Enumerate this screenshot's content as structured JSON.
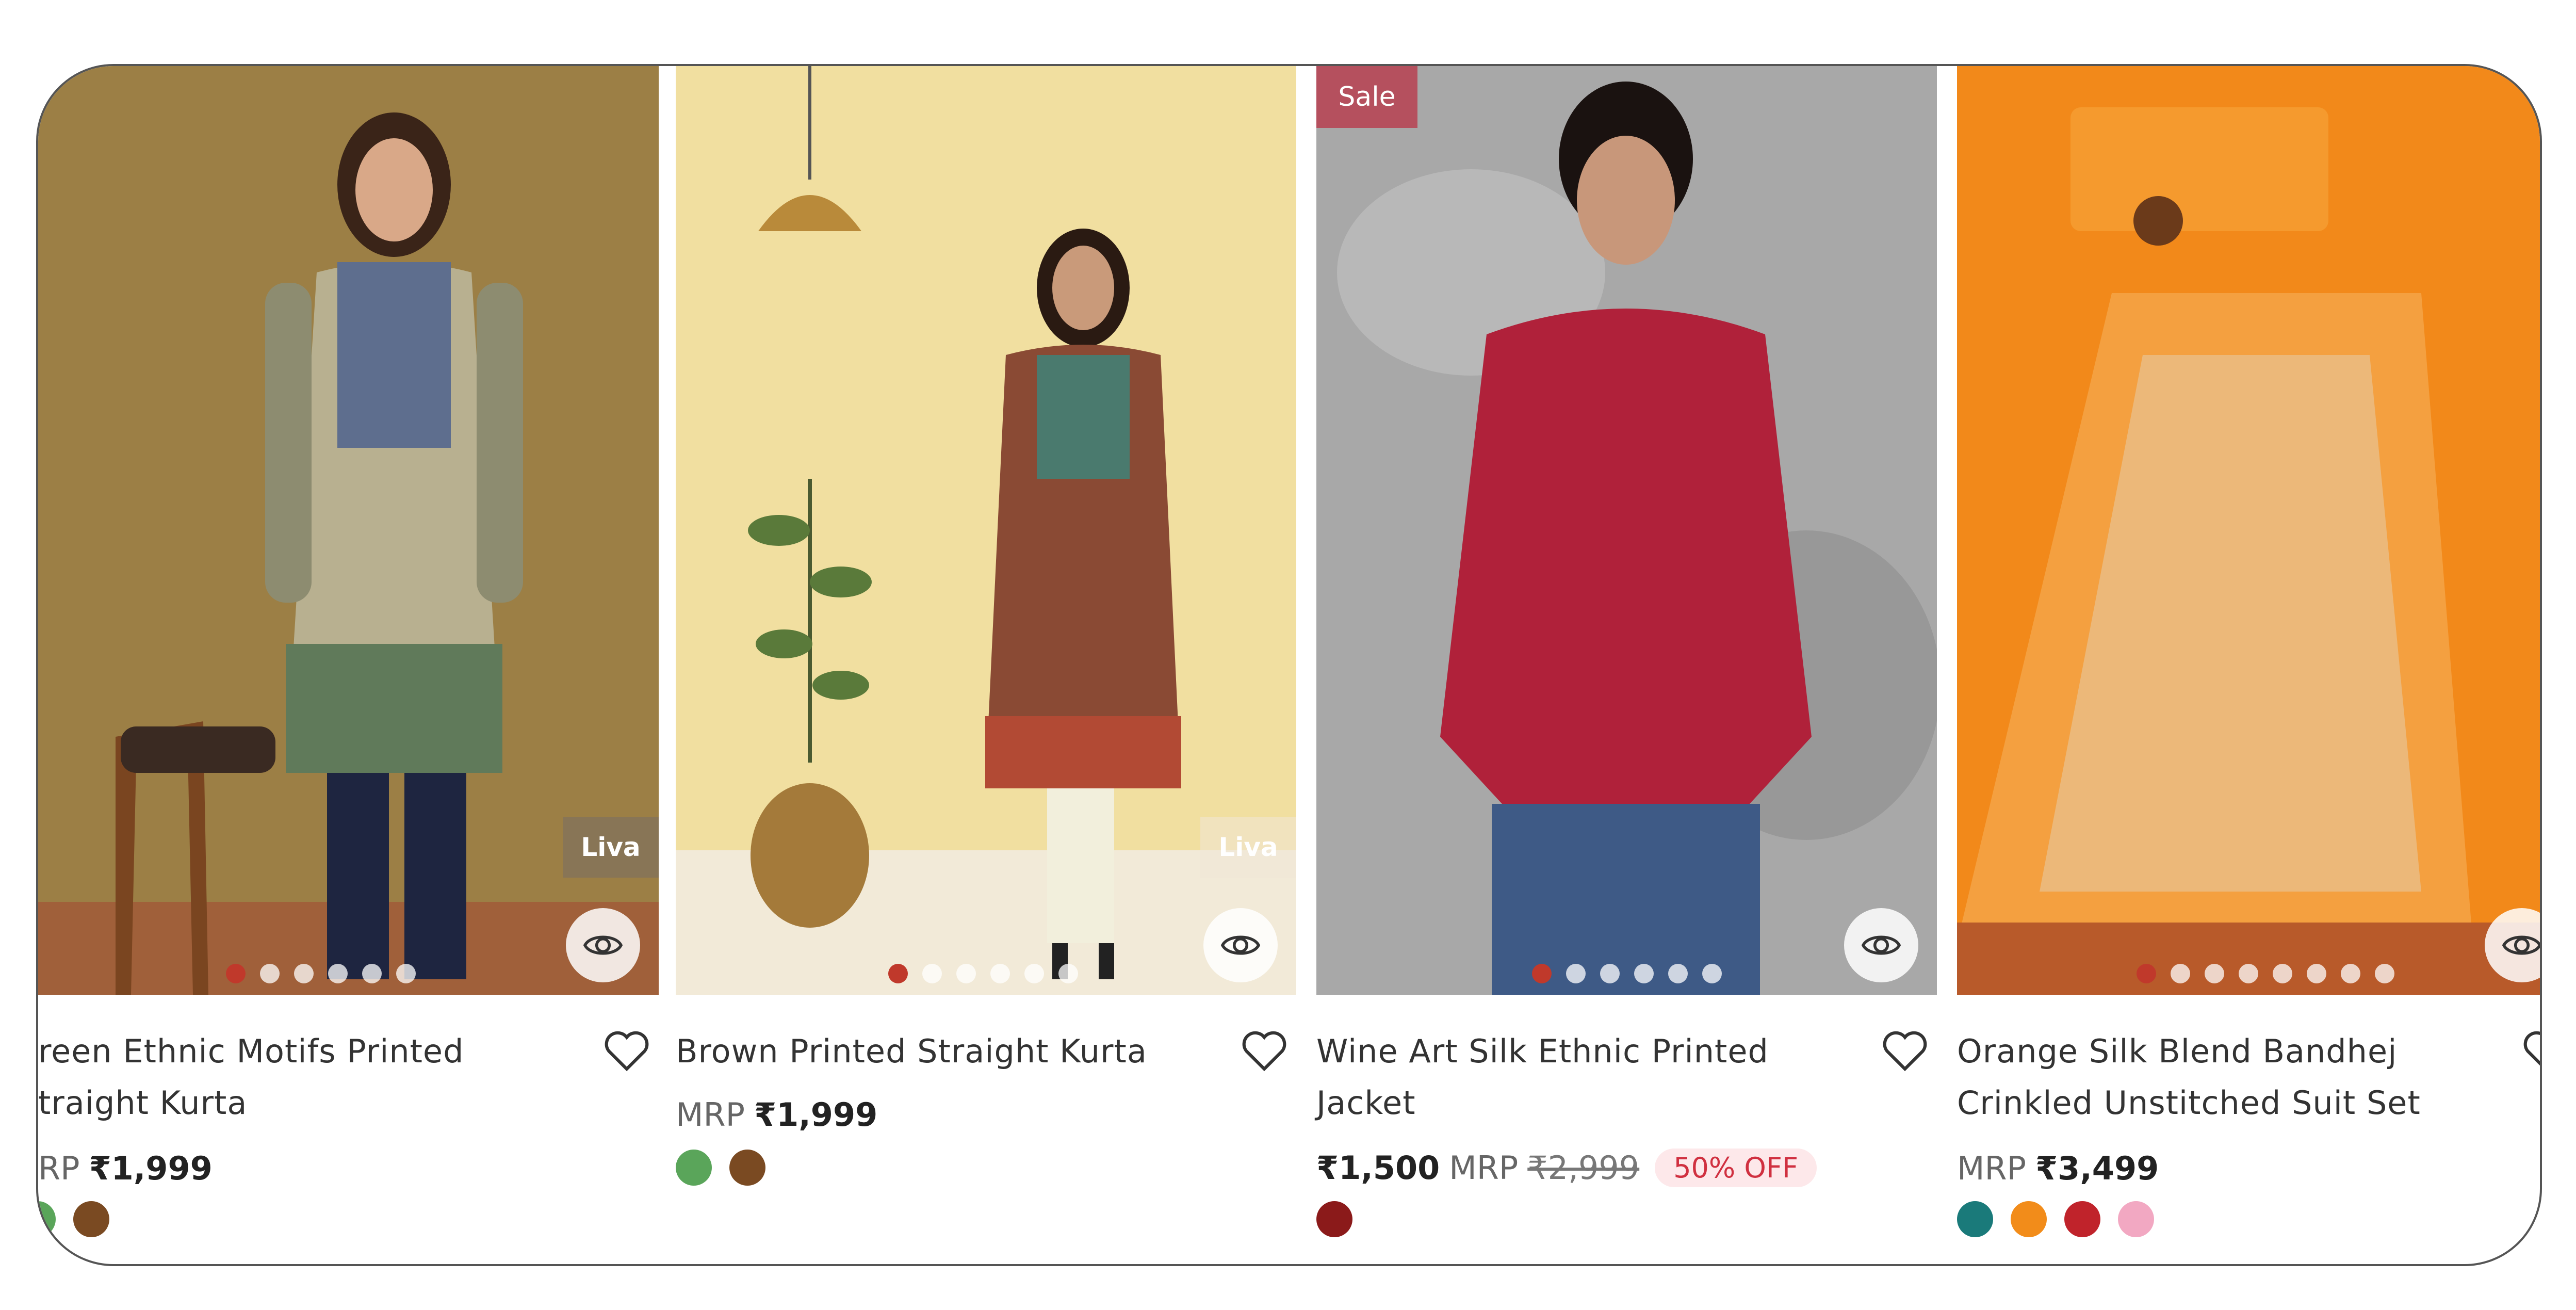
{
  "products": [
    {
      "title_line1": "reen Ethnic Motifs Printed",
      "title_line2": "traight Kurta",
      "mrp_label": "RP",
      "price": "₹1,999",
      "brand": "Liva",
      "swatches": [
        "#7a4a22"
      ]
    },
    {
      "title_line1": "Brown Printed Straight Kurta",
      "title_line2": "",
      "mrp_label": "MRP",
      "price": "₹1,999",
      "brand": "Liva",
      "swatches": [
        "#5aa55a",
        "#7a4a22"
      ]
    },
    {
      "title_line1": "Wine Art Silk Ethnic Printed",
      "title_line2": "Jacket",
      "sale_badge": "Sale",
      "sale_price": "₹1,500",
      "mrp_label": "MRP",
      "original_price": "₹2,999",
      "discount": "50% OFF",
      "swatches": [
        "#8b1a1a"
      ]
    },
    {
      "title_line1": "Orange Silk Blend Bandhej",
      "title_line2": "Crinkled Unstitched Suit Set",
      "mrp_label": "MRP",
      "price": "₹3,499",
      "swatches": [
        "#1a7a7a",
        "#f28c1a",
        "#c0232b",
        "#f2a8c2"
      ]
    }
  ],
  "icons": {
    "quick_view": "eye-icon",
    "wishlist": "heart-outline-icon"
  },
  "carousel": [
    {
      "count": 6,
      "active": 1
    },
    {
      "count": 6,
      "active": 1
    },
    {
      "count": 6,
      "active": 1
    },
    {
      "count": 8,
      "active": 1
    }
  ]
}
